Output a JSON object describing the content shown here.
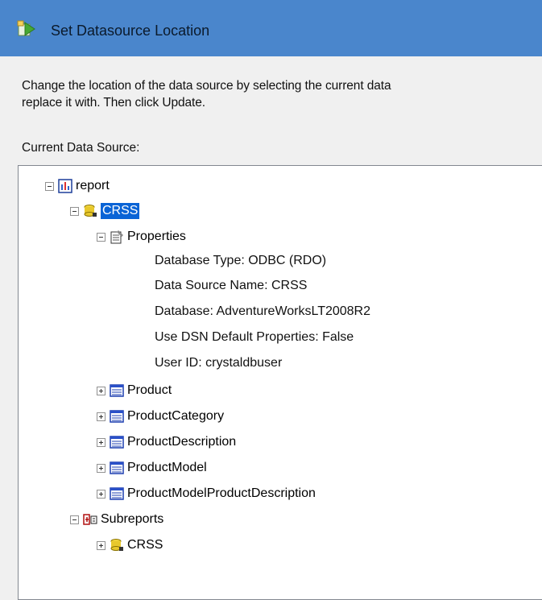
{
  "dialog": {
    "title": "Set Datasource Location",
    "instructions_line1": "Change the location of the data source by selecting the current data",
    "instructions_line2": "replace it with.  Then click Update.",
    "current_label": "Current Data Source:"
  },
  "tree": {
    "root": "report",
    "datasource": "CRSS",
    "properties_label": "Properties",
    "properties": [
      "Database Type: ODBC (RDO)",
      "Data Source Name: CRSS",
      "Database: AdventureWorksLT2008R2",
      "Use DSN Default Properties: False",
      "User ID: crystaldbuser"
    ],
    "tables": [
      "Product",
      "ProductCategory",
      "ProductDescription",
      "ProductModel",
      "ProductModelProductDescription"
    ],
    "subreports_label": "Subreports",
    "subreport_datasource": "CRSS"
  },
  "colors": {
    "titlebar": "#4a86cc",
    "selection": "#0a64d6"
  }
}
